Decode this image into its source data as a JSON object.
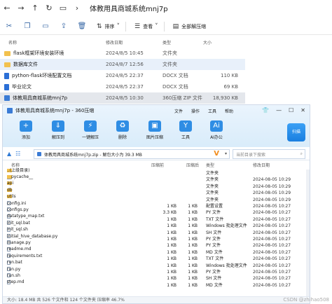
{
  "explorer": {
    "title": "体教用具商城系统mnj7p",
    "toolbar": {
      "sort": "排序",
      "view": "查看",
      "extract": "全部解压缩"
    },
    "headers": {
      "name": "名称",
      "date": "修改日期",
      "type": "类型",
      "size": "大小"
    },
    "rows": [
      {
        "name": "flask框架环境安装环境",
        "date": "2024/8/5 10:45",
        "type": "文件夹",
        "size": ""
      },
      {
        "name": "数据库文件",
        "date": "2024/8/7 12:56",
        "type": "文件夹",
        "size": ""
      },
      {
        "name": "python-flask环境配置文档",
        "date": "2024/8/5 22:37",
        "type": "DOCX 文档",
        "size": "110 KB"
      },
      {
        "name": "毕业论文",
        "date": "2024/8/5 22:37",
        "type": "DOCX 文档",
        "size": "69 KB"
      },
      {
        "name": "体教用具商城系统mnj7p",
        "date": "2024/8/5 10:30",
        "type": "360压缩 ZIP 文件",
        "size": "18,930 KB"
      }
    ]
  },
  "zip": {
    "title": "体教用具商城系统mnj7p - 360压缩",
    "menu": [
      "文件",
      "操作",
      "工具",
      "帮助"
    ],
    "tools": [
      "添加",
      "解压到",
      "一键解压",
      "删除",
      "图片压缩",
      "工具",
      "AI办公"
    ],
    "scan": "扫描",
    "path": "体教用具商城系统mnj7p.zip - 解包大小为 39.3 MB",
    "search_placeholder": "当前目录下搜索",
    "headers": {
      "name": "名称",
      "csize": "压缩前",
      "psize": "压缩后",
      "type": "类型",
      "date": "修改日期"
    },
    "rows": [
      {
        "name": "..(上级目录)",
        "csize": "",
        "psize": "",
        "type": "文件夹",
        "date": "",
        "kind": "folder"
      },
      {
        "name": "__pycache__",
        "csize": "",
        "psize": "",
        "type": "文件夹",
        "date": "2024-08-05 10:29",
        "kind": "folder"
      },
      {
        "name": "api",
        "csize": "",
        "psize": "",
        "type": "文件夹",
        "date": "2024-08-05 10:29",
        "kind": "folder"
      },
      {
        "name": "db",
        "csize": "",
        "psize": "",
        "type": "文件夹",
        "date": "2024-08-05 10:29",
        "kind": "folder"
      },
      {
        "name": "utils",
        "csize": "",
        "psize": "",
        "type": "文件夹",
        "date": "2024-08-05 10:29",
        "kind": "folder"
      },
      {
        "name": "config.ini",
        "csize": "1 KB",
        "psize": "1 KB",
        "type": "配置设置",
        "date": "2024-08-05 10:27",
        "kind": "file"
      },
      {
        "name": "configs.py",
        "csize": "3.3 KB",
        "psize": "1 KB",
        "type": "PY 文件",
        "date": "2024-08-05 10:27",
        "kind": "file"
      },
      {
        "name": "datatype_map.txt",
        "csize": "1 KB",
        "psize": "1 KB",
        "type": "TXT 文件",
        "date": "2024-08-05 10:27",
        "kind": "file"
      },
      {
        "name": "init_sql.bat",
        "csize": "1 KB",
        "psize": "1 KB",
        "type": "Windows 批处理文件",
        "date": "2024-08-05 10:27",
        "kind": "file"
      },
      {
        "name": "init_sql.sh",
        "csize": "1 KB",
        "psize": "1 KB",
        "type": "SH 文件",
        "date": "2024-08-05 10:27",
        "kind": "file"
      },
      {
        "name": "initial_hive_database.py",
        "csize": "1 KB",
        "psize": "1 KB",
        "type": "PY 文件",
        "date": "2024-08-05 10:27",
        "kind": "file"
      },
      {
        "name": "manage.py",
        "csize": "1 KB",
        "psize": "1 KB",
        "type": "PY 文件",
        "date": "2024-08-05 10:27",
        "kind": "file"
      },
      {
        "name": "readme.md",
        "csize": "1 KB",
        "psize": "1 KB",
        "type": "MD 文件",
        "date": "2024-08-05 10:27",
        "kind": "file"
      },
      {
        "name": "requirements.txt",
        "csize": "1 KB",
        "psize": "1 KB",
        "type": "TXT 文件",
        "date": "2024-08-05 10:27",
        "kind": "file"
      },
      {
        "name": "run.bat",
        "csize": "1 KB",
        "psize": "1 KB",
        "type": "Windows 批处理文件",
        "date": "2024-08-05 10:27",
        "kind": "file"
      },
      {
        "name": "run.py",
        "csize": "1 KB",
        "psize": "1 KB",
        "type": "PY 文件",
        "date": "2024-08-05 10:27",
        "kind": "file"
      },
      {
        "name": "run.sh",
        "csize": "1 KB",
        "psize": "1 KB",
        "type": "SH 文件",
        "date": "2024-08-05 10:27",
        "kind": "file"
      },
      {
        "name": "step.md",
        "csize": "1 KB",
        "psize": "1 KB",
        "type": "MD 文件",
        "date": "2024-08-05 10:27",
        "kind": "file"
      }
    ],
    "status": "大小: 18.4 MB 共 526 个文件和 124 个文件夹 压缩率 46.7%"
  },
  "watermark": "CSDN @zhihao508"
}
